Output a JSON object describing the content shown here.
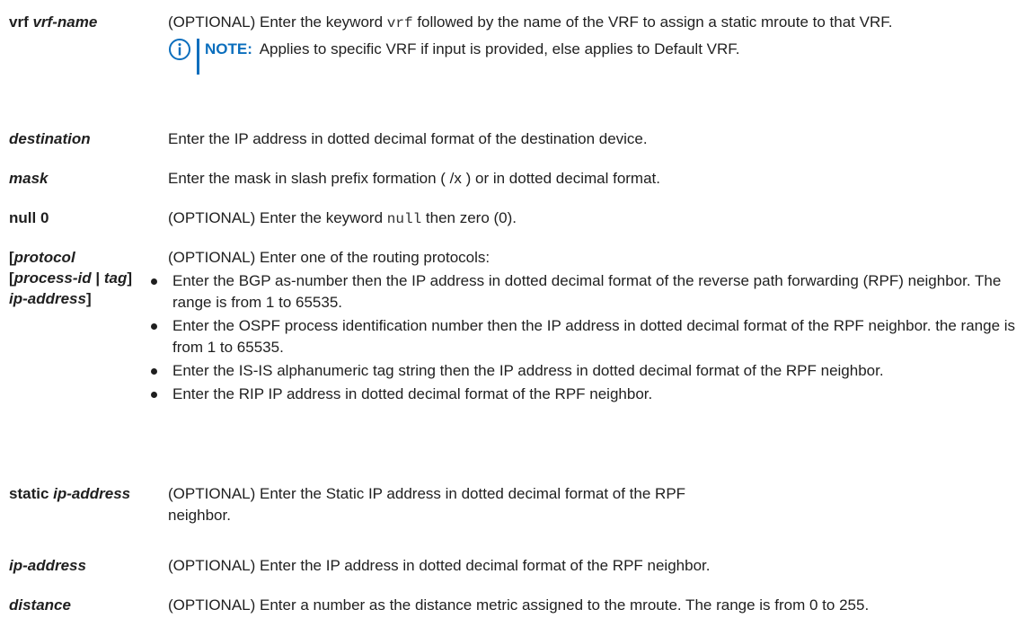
{
  "rows": {
    "vrf": {
      "term_bold": "vrf",
      "term_italic": "vrf-name",
      "desc_a": "(OPTIONAL) Enter the keyword",
      "desc_code": "vrf",
      "desc_b": "followed by the name of the VRF to assign a static mroute to that VRF.",
      "note_label": "NOTE:",
      "note_text": "Applies to specific VRF if input is provided, else applies to Default VRF."
    },
    "destination": {
      "term": "destination",
      "desc": "Enter the IP address in dotted decimal format of the destination device."
    },
    "mask": {
      "term": "mask",
      "desc": "Enter the mask in slash prefix formation ( /x ) or in dotted decimal format."
    },
    "null": {
      "term": "null 0",
      "desc_a": "(OPTIONAL) Enter the keyword",
      "desc_code": "null",
      "desc_b": "then zero (0)."
    },
    "protocol": {
      "t1": "[",
      "t2": "protocol",
      "t3": "[",
      "t4": "process-id",
      "t5": " | ",
      "t6": "tag",
      "t7": "]",
      "t8": "ip-address",
      "t9": "]",
      "desc": "(OPTIONAL) Enter one of the routing protocols:",
      "bullets": [
        "Enter the BGP as-number then the IP address in dotted decimal format of the reverse path forwarding (RPF) neighbor. The range is from 1 to 65535.",
        "Enter the OSPF process identification number then the IP address in dotted decimal format of the RPF neighbor. the range is from 1 to 65535.",
        "Enter the IS-IS alphanumeric tag string then the IP address in dotted decimal format of the RPF neighbor.",
        "Enter the RIP IP address in dotted decimal format of the RPF neighbor."
      ]
    },
    "static": {
      "term_bold": "static",
      "term_italic": "ip-address",
      "desc": "(OPTIONAL) Enter the Static IP address in dotted decimal format of the RPF neighbor."
    },
    "ip_address": {
      "term": "ip-address",
      "desc": "(OPTIONAL) Enter the IP address in dotted decimal format of the RPF neighbor."
    },
    "distance": {
      "term": "distance",
      "desc": "(OPTIONAL) Enter a number as the distance metric assigned to the mroute. The range is from 0 to 255."
    }
  },
  "colors": {
    "note_accent": "#0a6ebd",
    "text": "#1f1f1f"
  },
  "icons": {
    "note": "info-icon"
  }
}
